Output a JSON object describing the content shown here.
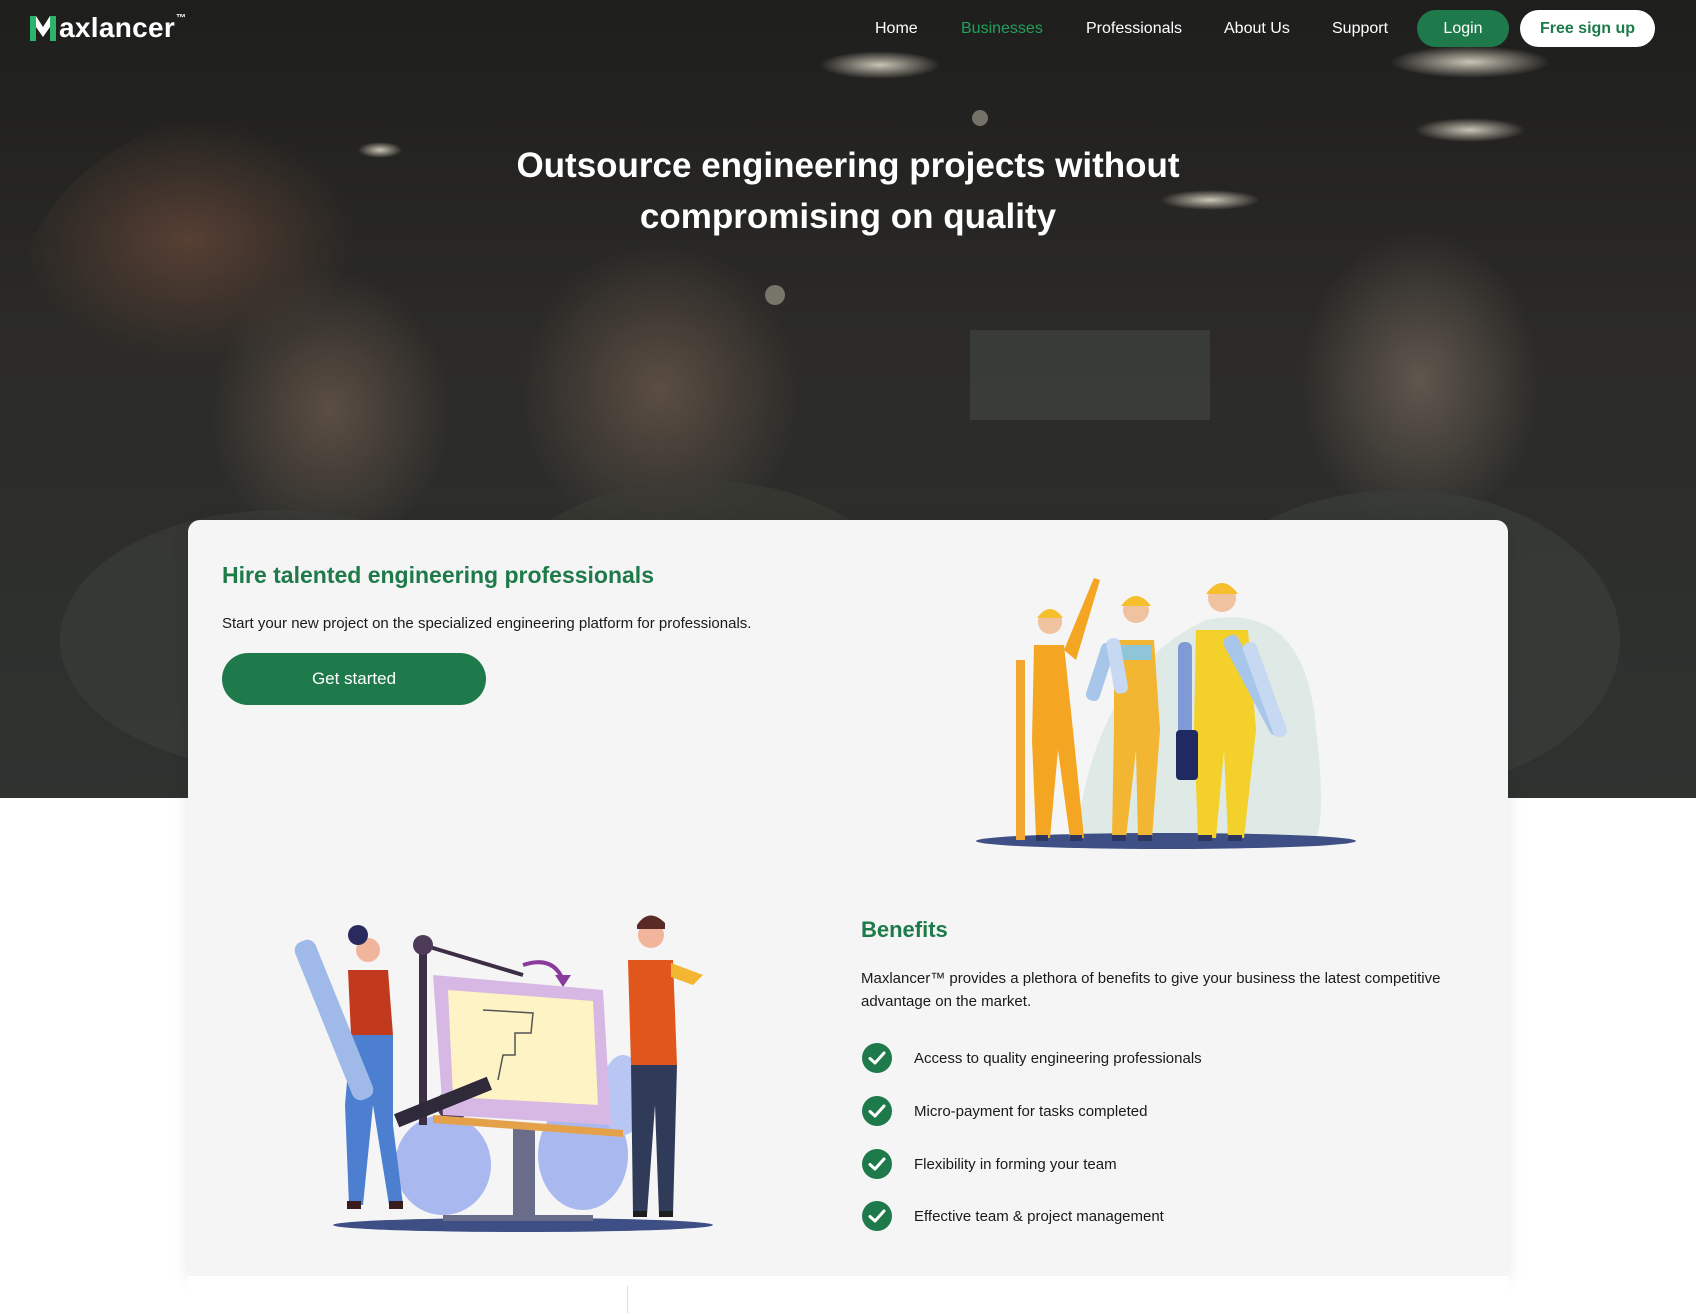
{
  "nav": {
    "logo_text": "axlancer",
    "logo_tm": "™",
    "links": [
      "Home",
      "Businesses",
      "Professionals",
      "About Us",
      "Support"
    ],
    "active": "Businesses",
    "login": "Login",
    "signup": "Free sign up"
  },
  "hero": {
    "title_line1": "Outsource engineering projects without",
    "title_line2": "compromising on quality"
  },
  "hire": {
    "title": "Hire talented engineering professionals",
    "subtitle": "Start your new project on the specialized engineering platform for professionals.",
    "cta": "Get started"
  },
  "benefits": {
    "title": "Benefits",
    "description": "Maxlancer™ provides a plethora of benefits to give your business the latest competitive advantage on the market.",
    "items": [
      "Access to quality engineering professionals",
      "Micro-payment for tasks completed",
      "Flexibility in forming your team",
      "Effective team & project management"
    ]
  },
  "colors": {
    "brand_green": "#1e7a49",
    "nav_active": "#21a05a",
    "hero_overlay": "#2b2a27",
    "card_bg": "#f5f5f5"
  },
  "icons": [
    "maxlancer-logo-icon",
    "check-circle-icon",
    "workers-illustration",
    "drafting-illustration",
    "hero-background-photo"
  ]
}
